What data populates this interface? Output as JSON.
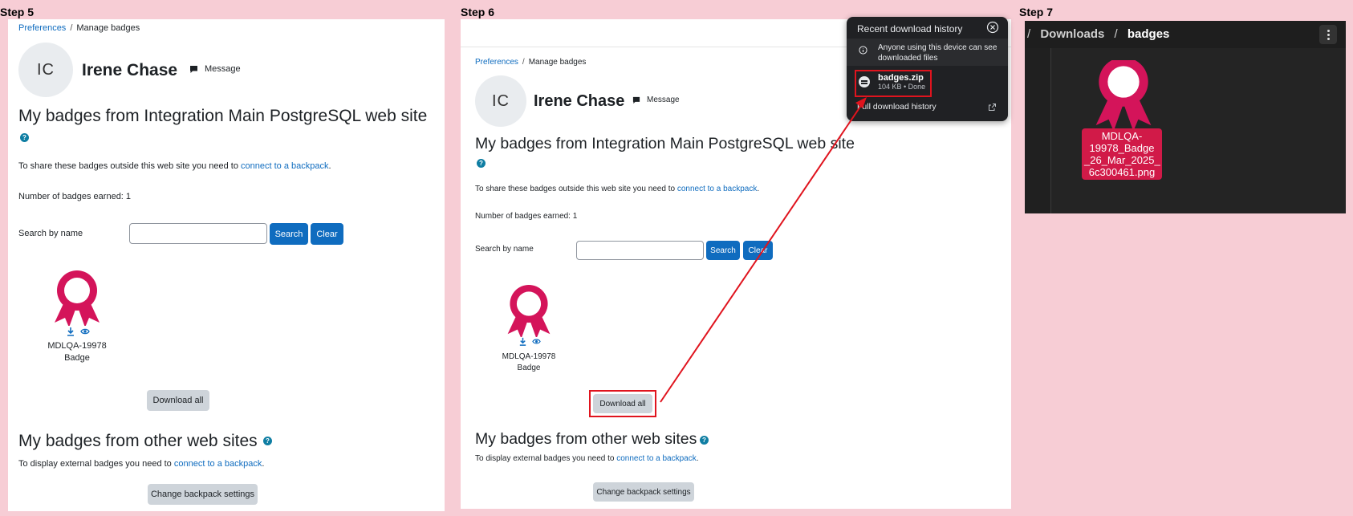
{
  "steps": {
    "step5": "Step 5",
    "step6": "Step 6",
    "step7": "Step 7"
  },
  "breadcrumb": {
    "parent": "Preferences",
    "separator": "/",
    "current": "Manage badges"
  },
  "user": {
    "initials": "IC",
    "name": "Irene Chase",
    "message_label": "Message"
  },
  "headings": {
    "my_badges": "My badges from Integration Main PostgreSQL web site",
    "other_sites": "My badges from other web sites"
  },
  "help_glyph": "?",
  "share_text": {
    "prefix": "To share these badges outside this web site you need to",
    "link": "connect to a backpack",
    "suffix": "."
  },
  "badges_count": "Number of badges earned: 1",
  "search": {
    "label": "Search by name",
    "value": "",
    "search_button": "Search",
    "clear_button": "Clear"
  },
  "badge": {
    "line1": "MDLQA-19978",
    "line2": "Badge",
    "color": "#d4145a"
  },
  "download_all_button": "Download all",
  "external_text": {
    "prefix": "To display external badges you need to",
    "link": "connect to a backpack",
    "suffix": "."
  },
  "change_backpack_button": "Change backpack settings",
  "download_popup": {
    "title": "Recent download history",
    "info_line1": "Anyone using this device can see",
    "info_line2": "downloaded files",
    "file_name": "badges.zip",
    "file_meta": "104 KB • Done",
    "full_history": "Full download history"
  },
  "file_manager": {
    "path_lead": "/",
    "path_folder": "Downloads",
    "path_sep": "/",
    "path_current": "badges",
    "file_name_lines": [
      "MDLQA-",
      "19978_Badge",
      "_26_Mar_2025_",
      "6c300461.png"
    ]
  },
  "colors": {
    "background": "#f7cdd5",
    "link": "#0f6cbf",
    "primary": "#0f6cbf",
    "secondary": "#ced4da",
    "highlight": "#e0141e",
    "popup_bg": "#202124",
    "fm_bg": "#242424"
  }
}
